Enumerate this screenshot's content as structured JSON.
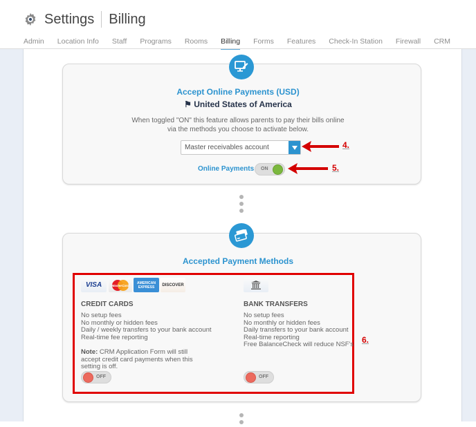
{
  "header": {
    "title": "Settings",
    "subtitle": "Billing",
    "icon": "gear-icon"
  },
  "tabs": [
    {
      "label": "Admin",
      "active": false
    },
    {
      "label": "Location Info",
      "active": false
    },
    {
      "label": "Staff",
      "active": false
    },
    {
      "label": "Programs",
      "active": false
    },
    {
      "label": "Rooms",
      "active": false
    },
    {
      "label": "Billing",
      "active": true
    },
    {
      "label": "Forms",
      "active": false
    },
    {
      "label": "Features",
      "active": false
    },
    {
      "label": "Check-In Station",
      "active": false
    },
    {
      "label": "Firewall",
      "active": false
    },
    {
      "label": "CRM",
      "active": false
    }
  ],
  "online_payments_card": {
    "icon": "monitor-edit-icon",
    "title": "Accept Online Payments (USD)",
    "country_flag_icon": "flag-icon",
    "country": "United States of America",
    "description_line1": "When toggled \"ON\" this feature allows parents to pay their bills online",
    "description_line2": "via the methods you choose to activate below.",
    "account_select": {
      "value": "Master receivables account"
    },
    "toggle_label": "Online Payments",
    "toggle_state": "ON"
  },
  "payment_methods_card": {
    "icon": "credit-cards-icon",
    "title": "Accepted Payment Methods",
    "credit_cards": {
      "logos": [
        "VISA",
        "MasterCard",
        "AMERICAN EXPRESS",
        "DISCOVER"
      ],
      "title": "CREDIT CARDS",
      "features": [
        "No setup fees",
        "No monthly or hidden fees",
        "Daily / weekly transfers to your bank account",
        "Real-time fee reporting"
      ],
      "note_label": "Note:",
      "note_text": " CRM Application Form will still accept credit card payments when this setting is off.",
      "toggle_state": "OFF"
    },
    "bank_transfers": {
      "icon": "bank-icon",
      "title": "BANK TRANSFERS",
      "features": [
        "No setup fees",
        "No monthly or hidden fees",
        "Daily transfers to your bank account",
        "Real-time reporting",
        "Free BalanceCheck will reduce NSF's"
      ],
      "toggle_state": "OFF"
    }
  },
  "annotations": {
    "a4": "4.",
    "a5": "5.",
    "a6": "6.",
    "color": "#d40000"
  },
  "colors": {
    "accent": "#2c93cf",
    "toggle_on": "#7bb83e",
    "toggle_off": "#ec6a5e",
    "highlight_box": "#e00000"
  }
}
